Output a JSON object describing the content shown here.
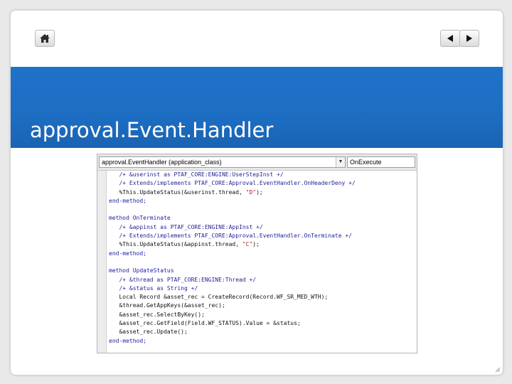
{
  "slide": {
    "title": "approval.Event.Handler"
  },
  "nav": {
    "home_icon": "home-icon",
    "prev_icon": "triangle-left-icon",
    "next_icon": "triangle-right-icon"
  },
  "editor": {
    "object_combo": "approval.EventHandler   (application_class)",
    "method_combo": "OnExecute",
    "lines": [
      [
        {
          "t": "   /+ &userinst as PTAF_CORE:ENGINE:UserStepInst +/",
          "c": "c"
        }
      ],
      [
        {
          "t": "   /+ Extends/implements PTAF_CORE:Approval.EventHandler.OnHeaderDeny +/",
          "c": "c"
        }
      ],
      [
        {
          "t": "   %This.UpdateStatus(&userinst.thread, ",
          "c": "d"
        },
        {
          "t": "\"D\"",
          "c": "s"
        },
        {
          "t": ");",
          "c": "d"
        }
      ],
      [
        {
          "t": "end-method;",
          "c": "k"
        }
      ],
      [
        {
          "t": "",
          "c": "d"
        }
      ],
      [
        {
          "t": "method OnTerminate",
          "c": "k"
        }
      ],
      [
        {
          "t": "   /+ &appinst as PTAF_CORE:ENGINE:AppInst +/",
          "c": "c"
        }
      ],
      [
        {
          "t": "   /+ Extends/implements PTAF_CORE:Approval.EventHandler.OnTerminate +/",
          "c": "c"
        }
      ],
      [
        {
          "t": "   %This.UpdateStatus(&appinst.thread, ",
          "c": "d"
        },
        {
          "t": "\"C\"",
          "c": "s"
        },
        {
          "t": ");",
          "c": "d"
        }
      ],
      [
        {
          "t": "end-method;",
          "c": "k"
        }
      ],
      [
        {
          "t": "",
          "c": "d"
        }
      ],
      [
        {
          "t": "method UpdateStatus",
          "c": "k"
        }
      ],
      [
        {
          "t": "   /+ &thread as PTAF_CORE:ENGINE:Thread +/",
          "c": "c"
        }
      ],
      [
        {
          "t": "   /+ &status as String +/",
          "c": "c"
        }
      ],
      [
        {
          "t": "   Local Record &asset_rec = CreateRecord(Record.WF_SR_MED_WTH);",
          "c": "d"
        }
      ],
      [
        {
          "t": "   &thread.GetAppKeys(&asset_rec);",
          "c": "d"
        }
      ],
      [
        {
          "t": "   &asset_rec.SelectByKey();",
          "c": "d"
        }
      ],
      [
        {
          "t": "   &asset_rec.GetField(Field.WF_STATUS).Value = &status;",
          "c": "d"
        }
      ],
      [
        {
          "t": "   &asset_rec.Update();",
          "c": "d"
        }
      ],
      [
        {
          "t": "end-method;",
          "c": "k"
        }
      ]
    ]
  },
  "colors": {
    "banner": "#1d6fc4",
    "keyword": "#1a1aa8",
    "comment": "#1f1f96",
    "string": "#b3141c"
  }
}
